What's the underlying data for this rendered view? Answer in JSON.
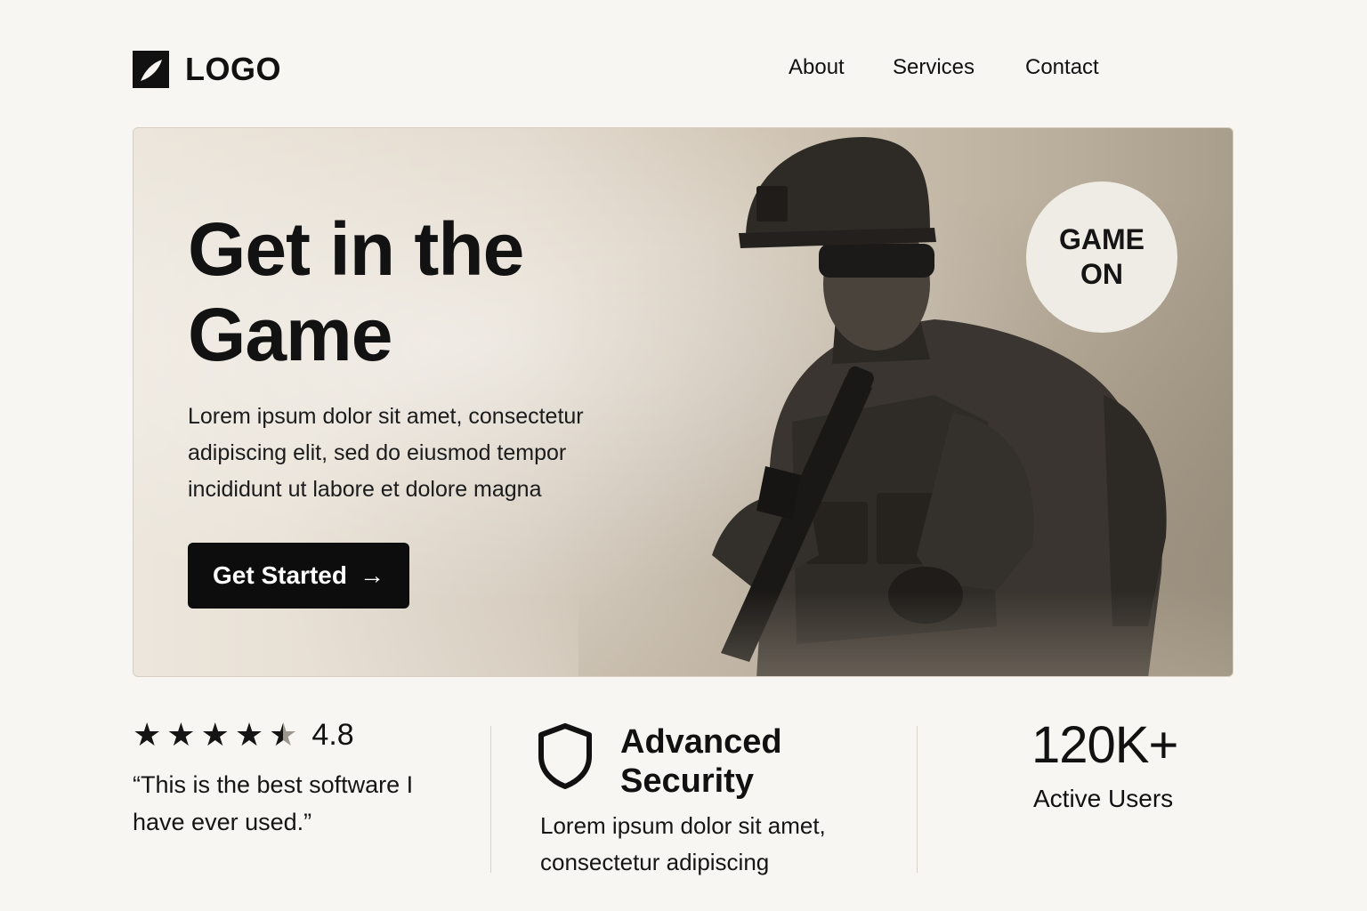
{
  "header": {
    "logo_text": "LOGO",
    "nav": [
      {
        "label": "About"
      },
      {
        "label": "Services"
      },
      {
        "label": "Contact"
      }
    ]
  },
  "hero": {
    "title": "Get in the Game",
    "description": "Lorem ipsum dolor sit amet, consectetur adipiscing elit, sed do eiusmod tempor incididunt ut labore et dolore magna",
    "cta_label": "Get Started",
    "cta_icon": "arrow-right-icon",
    "badge_line1": "GAME",
    "badge_line2": "ON",
    "image": "soldier-with-rifle"
  },
  "features": {
    "rating": {
      "stars": 4.5,
      "value": "4.8",
      "quote": "“This is the best software I have ever used.”"
    },
    "security": {
      "icon": "shield-icon",
      "title": "Advanced Security",
      "text": "Lorem ipsum dolor sit amet, consectetur adipiscing"
    },
    "users": {
      "count": "120K+",
      "label": "Active Users"
    }
  },
  "colors": {
    "background": "#f7f6f2",
    "text": "#111111",
    "button": "#0d0d0d",
    "badge": "#efebe5"
  }
}
